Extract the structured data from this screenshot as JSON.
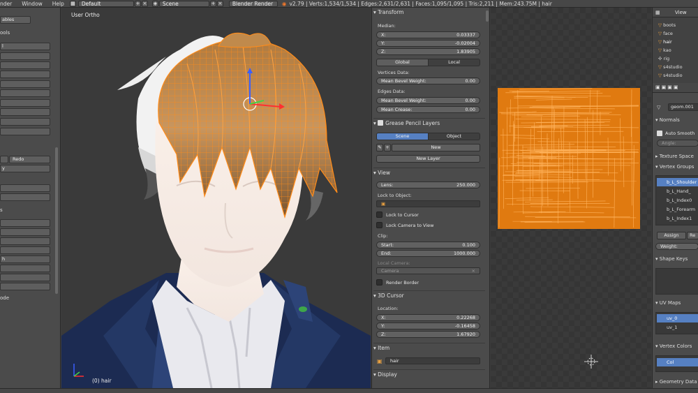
{
  "topbar": {
    "menu_render": "nder",
    "menu_window": "Window",
    "menu_help": "Help",
    "screen_layout": "Default",
    "scene": "Scene",
    "engine": "Blender Render",
    "stats": "v2.79 | Verts:1,534/1,534 | Edges:2,631/2,631 | Faces:1,095/1,095 | Tris:2,211 | Mem:243.75M | hair"
  },
  "toolshelf": {
    "title": "ools",
    "item_top": "ables",
    "item_first": "l",
    "redo": "Redo",
    "item_y": "y",
    "item_h": "h",
    "section_s": "s",
    "mode": "ode"
  },
  "viewport": {
    "view_label": "User Ortho",
    "object_label": "(0) hair"
  },
  "transform": {
    "header": "Transform",
    "median_label": "Median:",
    "x_label": "X:",
    "x_value": "0.03337",
    "y_label": "Y:",
    "y_value": "-0.02004",
    "z_label": "Z:",
    "z_value": "1.83905",
    "global": "Global",
    "local": "Local",
    "vertices_data": "Vertices Data:",
    "mean_bevel_weight_label": "Mean Bevel Weight:",
    "vert_bevel_value": "0.00",
    "edges_data": "Edges Data:",
    "edge_bevel_value": "0.00",
    "mean_crease_label": "Mean Crease:",
    "crease_value": "0.00"
  },
  "grease_pencil": {
    "header": "Grease Pencil Layers",
    "scene": "Scene",
    "object": "Object",
    "new": "New",
    "new_layer": "New Layer"
  },
  "view": {
    "header": "View",
    "lens_label": "Lens:",
    "lens_value": "250.000",
    "lock_to_object": "Lock to Object:",
    "lock_to_cursor": "Lock to Cursor",
    "lock_camera": "Lock Camera to View",
    "clip": "Clip:",
    "start_label": "Start:",
    "start_value": "0.100",
    "end_label": "End:",
    "end_value": "1000.000",
    "local_camera": "Local Camera:",
    "camera": "Camera",
    "render_border": "Render Border"
  },
  "cursor": {
    "header": "3D Cursor",
    "location": "Location:",
    "x_label": "X:",
    "x_value": "0.22268",
    "y_label": "Y:",
    "y_value": "-0.16458",
    "z_label": "Z:",
    "z_value": "1.67920"
  },
  "item": {
    "header": "Item",
    "name": "hair"
  },
  "display": {
    "header": "Display"
  },
  "outliner": {
    "view": "View",
    "items": [
      "boots",
      "face",
      "hair",
      "kao",
      "rig",
      "s4studio",
      "s4studio"
    ]
  },
  "rprops": {
    "mesh_name": "geom.001",
    "normals": "Normals",
    "auto_smooth": "Auto Smooth",
    "angle": "Angle:",
    "texture_space": "Texture Space",
    "vertex_groups": "Vertex Groups",
    "groups": [
      "b_L_Shoulder",
      "b_L_Hand_",
      "b_L_Index0",
      "b_L_Forearm",
      "b_L_Index1"
    ],
    "assign": "Assign",
    "remove": "Re",
    "weight": "Weight:",
    "shape_keys": "Shape Keys",
    "uv_maps": "UV Maps",
    "uv0": "uv_0",
    "uv1": "uv_1",
    "vertex_colors": "Vertex Colors",
    "col": "Col",
    "geometry_data": "Geometry Data"
  },
  "colors": {
    "accent_blue": "#5680c2",
    "wire_orange": "#ff8c1a",
    "uv_orange": "#f7941d"
  }
}
